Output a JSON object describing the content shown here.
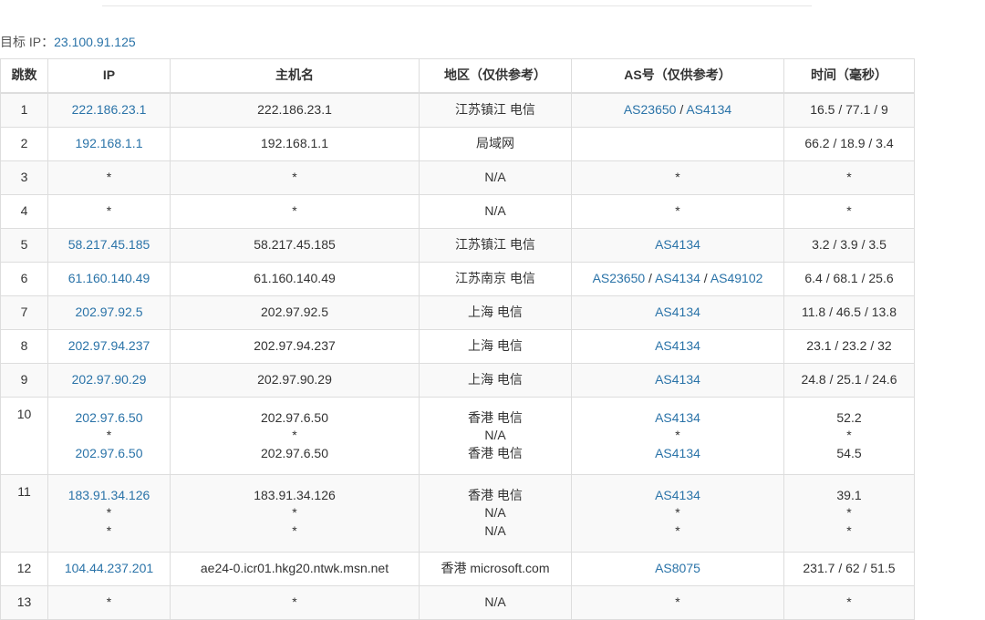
{
  "target": {
    "label": "目标 IP：",
    "ip": "23.100.91.125"
  },
  "columns": [
    "跳数",
    "IP",
    "主机名",
    "地区（仅供参考）",
    "AS号（仅供参考）",
    "时间（毫秒）"
  ],
  "hops": [
    {
      "hop": "1",
      "lines": [
        {
          "ip": "222.186.23.1",
          "host": "222.186.23.1",
          "region": "江苏镇江 电信",
          "as": [
            "AS23650",
            "AS4134"
          ],
          "time": "16.5 / 77.1 / 9"
        }
      ]
    },
    {
      "hop": "2",
      "lines": [
        {
          "ip": "192.168.1.1",
          "host": "192.168.1.1",
          "region": "局域网",
          "as": [],
          "time": "66.2 / 18.9 / 3.4"
        }
      ]
    },
    {
      "hop": "3",
      "lines": [
        {
          "ip": "*",
          "host": "*",
          "region": "N/A",
          "as": [
            "*"
          ],
          "time": "*"
        }
      ]
    },
    {
      "hop": "4",
      "lines": [
        {
          "ip": "*",
          "host": "*",
          "region": "N/A",
          "as": [
            "*"
          ],
          "time": "*"
        }
      ]
    },
    {
      "hop": "5",
      "lines": [
        {
          "ip": "58.217.45.185",
          "host": "58.217.45.185",
          "region": "江苏镇江 电信",
          "as": [
            "AS4134"
          ],
          "time": "3.2 / 3.9 / 3.5"
        }
      ]
    },
    {
      "hop": "6",
      "lines": [
        {
          "ip": "61.160.140.49",
          "host": "61.160.140.49",
          "region": "江苏南京 电信",
          "as": [
            "AS23650",
            "AS4134",
            "AS49102"
          ],
          "time": "6.4 / 68.1 / 25.6"
        }
      ]
    },
    {
      "hop": "7",
      "lines": [
        {
          "ip": "202.97.92.5",
          "host": "202.97.92.5",
          "region": "上海 电信",
          "as": [
            "AS4134"
          ],
          "time": "11.8 / 46.5 / 13.8"
        }
      ]
    },
    {
      "hop": "8",
      "lines": [
        {
          "ip": "202.97.94.237",
          "host": "202.97.94.237",
          "region": "上海 电信",
          "as": [
            "AS4134"
          ],
          "time": "23.1 / 23.2 / 32"
        }
      ]
    },
    {
      "hop": "9",
      "lines": [
        {
          "ip": "202.97.90.29",
          "host": "202.97.90.29",
          "region": "上海 电信",
          "as": [
            "AS4134"
          ],
          "time": "24.8 / 25.1 / 24.6"
        }
      ]
    },
    {
      "hop": "10",
      "lines": [
        {
          "ip": "202.97.6.50",
          "host": "202.97.6.50",
          "region": "香港 电信",
          "as": [
            "AS4134"
          ],
          "time": "52.2"
        },
        {
          "ip": "*",
          "host": "*",
          "region": "N/A",
          "as": [
            "*"
          ],
          "time": "*"
        },
        {
          "ip": "202.97.6.50",
          "host": "202.97.6.50",
          "region": "香港 电信",
          "as": [
            "AS4134"
          ],
          "time": "54.5"
        }
      ]
    },
    {
      "hop": "11",
      "lines": [
        {
          "ip": "183.91.34.126",
          "host": "183.91.34.126",
          "region": "香港 电信",
          "as": [
            "AS4134"
          ],
          "time": "39.1"
        },
        {
          "ip": "*",
          "host": "*",
          "region": "N/A",
          "as": [
            "*"
          ],
          "time": "*"
        },
        {
          "ip": "*",
          "host": "*",
          "region": "N/A",
          "as": [
            "*"
          ],
          "time": "*"
        }
      ]
    },
    {
      "hop": "12",
      "lines": [
        {
          "ip": "104.44.237.201",
          "host": "ae24-0.icr01.hkg20.ntwk.msn.net",
          "region": "香港 microsoft.com",
          "as": [
            "AS8075"
          ],
          "time": "231.7 / 62 / 51.5"
        }
      ]
    },
    {
      "hop": "13",
      "lines": [
        {
          "ip": "*",
          "host": "*",
          "region": "N/A",
          "as": [
            "*"
          ],
          "time": "*"
        }
      ]
    }
  ]
}
